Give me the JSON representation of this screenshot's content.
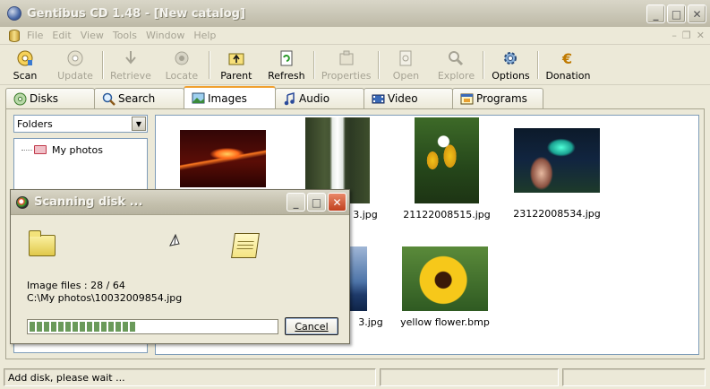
{
  "window": {
    "title": "Gentibus CD 1.48 - [New catalog]"
  },
  "menu": [
    "File",
    "Edit",
    "View",
    "Tools",
    "Window",
    "Help"
  ],
  "toolbar": [
    {
      "label": "Scan",
      "icon": "scan-icon",
      "enabled": true
    },
    {
      "label": "Update",
      "icon": "update-icon",
      "enabled": false
    },
    {
      "label": "Retrieve",
      "icon": "retrieve-icon",
      "enabled": false
    },
    {
      "label": "Locate",
      "icon": "locate-icon",
      "enabled": false
    },
    {
      "label": "Parent",
      "icon": "parent-folder-icon",
      "enabled": true
    },
    {
      "label": "Refresh",
      "icon": "refresh-icon",
      "enabled": true
    },
    {
      "label": "Properties",
      "icon": "properties-icon",
      "enabled": false
    },
    {
      "label": "Open",
      "icon": "open-icon",
      "enabled": false
    },
    {
      "label": "Explore",
      "icon": "explore-icon",
      "enabled": false
    },
    {
      "label": "Options",
      "icon": "options-icon",
      "enabled": true
    },
    {
      "label": "Donation",
      "icon": "donation-icon",
      "enabled": true
    }
  ],
  "tabs": [
    {
      "label": "Disks",
      "icon": "disks-icon"
    },
    {
      "label": "Search",
      "icon": "search-icon"
    },
    {
      "label": "Images",
      "icon": "images-icon",
      "active": true
    },
    {
      "label": "Audio",
      "icon": "audio-icon"
    },
    {
      "label": "Video",
      "icon": "video-icon"
    },
    {
      "label": "Programs",
      "icon": "programs-icon"
    }
  ],
  "sidebar": {
    "view_select": "Folders",
    "tree": [
      {
        "label": "My photos"
      }
    ]
  },
  "thumbnails": [
    {
      "caption": "",
      "kind": "volcano"
    },
    {
      "caption": "3.jpg",
      "kind": "waterfall"
    },
    {
      "caption": "21122008515.jpg",
      "kind": "flower-plant"
    },
    {
      "caption": "23122008534.jpg",
      "kind": "night-scene"
    },
    {
      "caption": "3.jpg",
      "kind": "sea"
    },
    {
      "caption": "yellow flower.bmp",
      "kind": "sunflower"
    }
  ],
  "dialog": {
    "title": "Scanning disk ...",
    "count_text": "Image files : 28 / 64",
    "path_text": "C:\\My photos\\10032009854.jpg",
    "progress": 0.4375,
    "cancel_label": "Cancel"
  },
  "status": {
    "message": "Add disk, please wait ..."
  },
  "colors": {
    "window_bg": "#ece9d8",
    "tab_active_accent": "#f0a030",
    "progress_fill": "#6a9a5a"
  }
}
